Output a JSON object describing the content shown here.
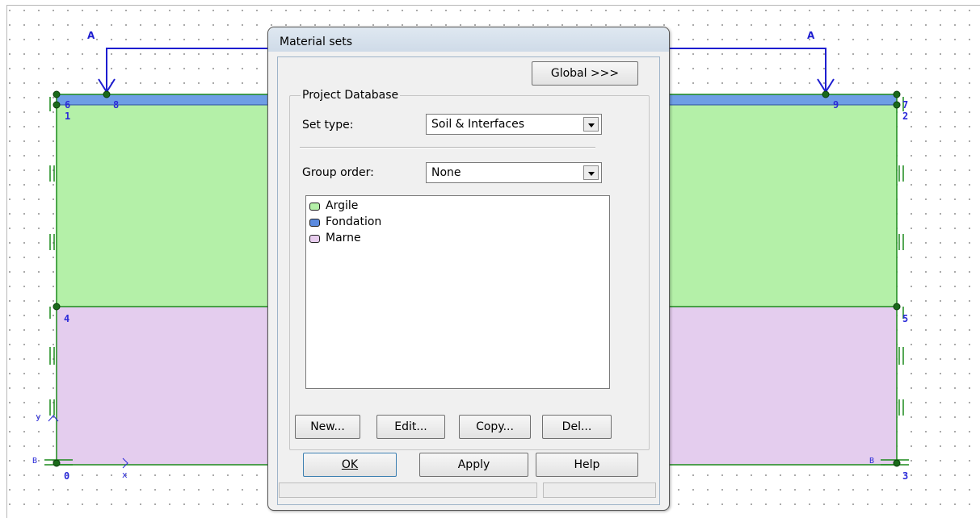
{
  "drawing": {
    "load_labels": [
      "A",
      "A",
      "B",
      "B"
    ],
    "node_labels": [
      "0",
      "1",
      "2",
      "3",
      "4",
      "5",
      "6",
      "7",
      "8",
      "9"
    ],
    "axis_labels": {
      "x": "x",
      "y": "y"
    },
    "colors": {
      "clay": "#b4f0a8",
      "marl": "#e4cdee",
      "foundation": "#6e9ee5",
      "outline": "#1c8a1c",
      "node": "#1a6a1a",
      "load": "#1e1ed0"
    }
  },
  "dialog": {
    "title": "Material sets",
    "global_button": "Global >>>",
    "group_title": "Project Database",
    "set_type_label": "Set type:",
    "set_type_value": "Soil & Interfaces",
    "group_order_label": "Group order:",
    "group_order_value": "None",
    "materials": [
      {
        "name": "Argile",
        "color": "#b4f0a8"
      },
      {
        "name": "Fondation",
        "color": "#5b8be0"
      },
      {
        "name": "Marne",
        "color": "#e8cdee"
      }
    ],
    "buttons": {
      "new": "New...",
      "edit": "Edit...",
      "copy": "Copy...",
      "del": "Del..."
    },
    "footer": {
      "ok": "OK",
      "apply": "Apply",
      "help": "Help"
    }
  }
}
